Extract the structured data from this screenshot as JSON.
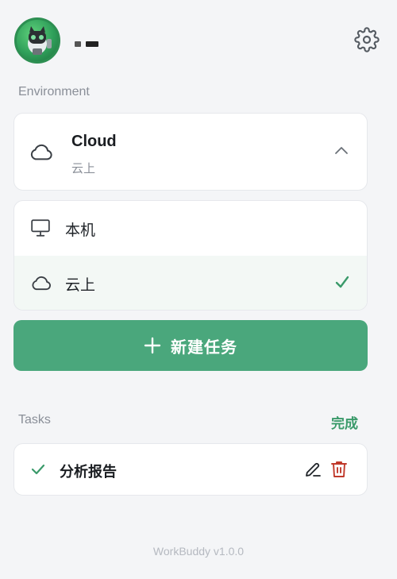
{
  "header": {
    "avatar_icon": "robot-avatar-icon",
    "settings_icon": "gear-icon"
  },
  "environment": {
    "section_label": "Environment",
    "selected_title": "Cloud",
    "selected_subtitle": "云上",
    "selected_icon": "cloud-icon",
    "expanded": true,
    "options": [
      {
        "label": "本机",
        "icon": "monitor-icon",
        "selected": false
      },
      {
        "label": "云上",
        "icon": "cloud-icon",
        "selected": true
      }
    ]
  },
  "new_task": {
    "label": "新建任务",
    "icon": "plus-icon"
  },
  "tasks": {
    "section_label": "Tasks",
    "done_label": "完成",
    "items": [
      {
        "label": "分析报告",
        "done": true
      }
    ]
  },
  "footer": {
    "version": "WorkBuddy v1.0.0"
  },
  "colors": {
    "accent": "#4aa77c",
    "accent_text": "#3a9a6a",
    "delete": "#c0392b",
    "background": "#f4f5f7"
  }
}
